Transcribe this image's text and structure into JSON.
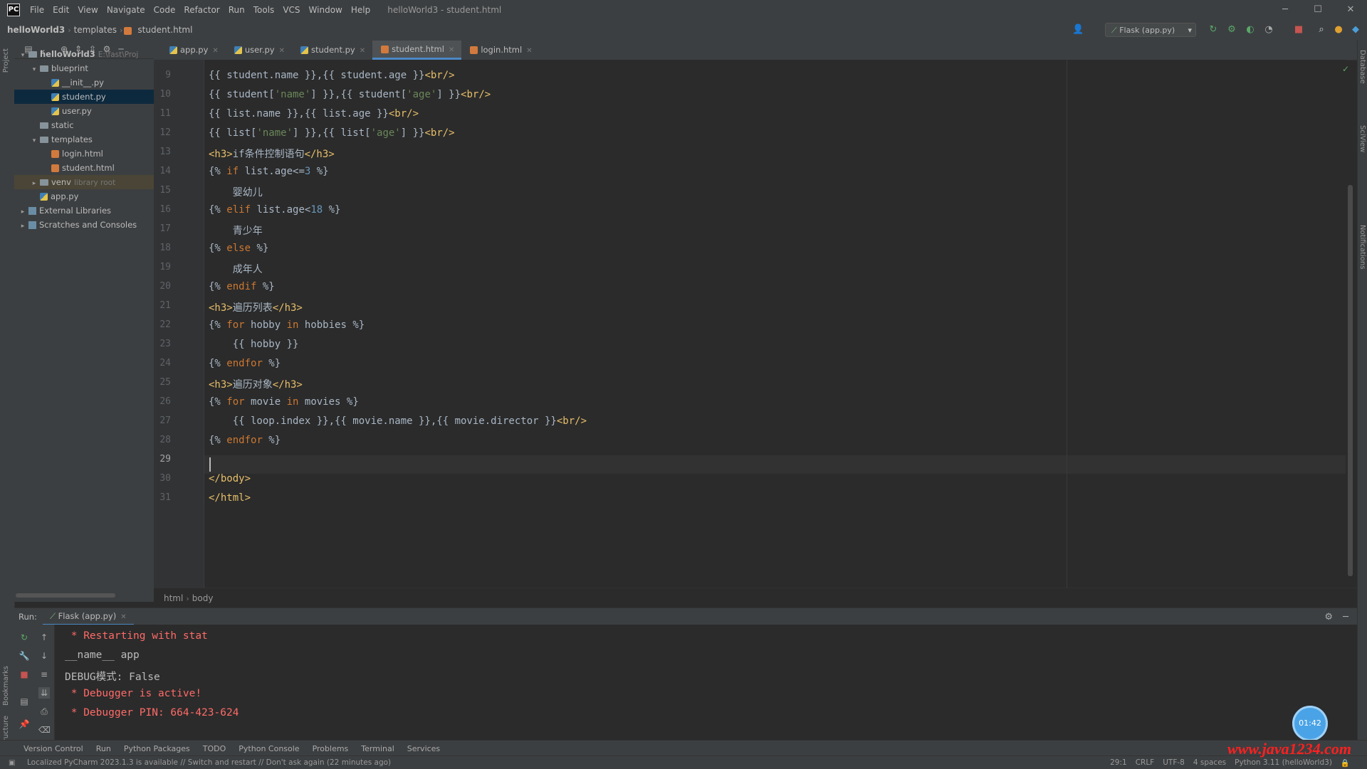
{
  "menubar": {
    "logo": "PC",
    "items": [
      "File",
      "Edit",
      "View",
      "Navigate",
      "Code",
      "Refactor",
      "Run",
      "Tools",
      "VCS",
      "Window",
      "Help"
    ],
    "window_title": "helloWorld3 - student.html",
    "minimize": "─",
    "maximize": "☐",
    "close": "✕"
  },
  "navbar": {
    "crumbs": [
      "helloWorld3",
      "templates",
      "student.html"
    ],
    "run_config": "Flask (app.py)"
  },
  "left_strip": {
    "project_label": "Project",
    "bookmarks_label": "Bookmarks",
    "structure_label": "Structure"
  },
  "right_strip": {
    "labels": [
      "Database",
      "SciView",
      "Notifications"
    ]
  },
  "project_tree": [
    {
      "label": "helloWorld3",
      "extra": "E:\\fast\\Proj",
      "depth": 0,
      "kind": "folder",
      "arrow": "▾"
    },
    {
      "label": "blueprint",
      "extra": "",
      "depth": 1,
      "kind": "folder",
      "arrow": "▾"
    },
    {
      "label": "__init__.py",
      "extra": "",
      "depth": 2,
      "kind": "py",
      "arrow": ""
    },
    {
      "label": "student.py",
      "extra": "",
      "depth": 2,
      "kind": "py",
      "arrow": "",
      "selected": true
    },
    {
      "label": "user.py",
      "extra": "",
      "depth": 2,
      "kind": "py",
      "arrow": ""
    },
    {
      "label": "static",
      "extra": "",
      "depth": 1,
      "kind": "folder",
      "arrow": ""
    },
    {
      "label": "templates",
      "extra": "",
      "depth": 1,
      "kind": "folder",
      "arrow": "▾"
    },
    {
      "label": "login.html",
      "extra": "",
      "depth": 2,
      "kind": "html",
      "arrow": ""
    },
    {
      "label": "student.html",
      "extra": "",
      "depth": 2,
      "kind": "html",
      "arrow": ""
    },
    {
      "label": "venv",
      "extra": "library root",
      "depth": 1,
      "kind": "folder",
      "arrow": "▸",
      "hl": true
    },
    {
      "label": "app.py",
      "extra": "",
      "depth": 1,
      "kind": "py",
      "arrow": ""
    },
    {
      "label": "External Libraries",
      "extra": "",
      "depth": 0,
      "kind": "lib",
      "arrow": "▸"
    },
    {
      "label": "Scratches and Consoles",
      "extra": "",
      "depth": 0,
      "kind": "lib",
      "arrow": "▸"
    }
  ],
  "tabs": [
    {
      "label": "app.py",
      "kind": "py"
    },
    {
      "label": "user.py",
      "kind": "py"
    },
    {
      "label": "student.py",
      "kind": "py"
    },
    {
      "label": "student.html",
      "kind": "html",
      "active": true
    },
    {
      "label": "login.html",
      "kind": "html"
    }
  ],
  "editor": {
    "line_numbers": [
      "9",
      "10",
      "11",
      "12",
      "13",
      "14",
      "15",
      "16",
      "17",
      "18",
      "19",
      "20",
      "21",
      "22",
      "23",
      "24",
      "25",
      "26",
      "27",
      "28",
      "29",
      "30",
      "31"
    ],
    "current_line": "29"
  },
  "breadcrumbs": [
    "html",
    "body"
  ],
  "run_panel": {
    "title": "Run:",
    "tab": "Flask (app.py)",
    "console": [
      {
        "text": " * Restarting with stat",
        "style": "red"
      },
      {
        "text": "__name__ app",
        "style": "gray"
      },
      {
        "text": "DEBUG模式: False",
        "style": "gray"
      },
      {
        "text": " * Debugger is active!",
        "style": "red"
      },
      {
        "text": " * Debugger PIN: 664-423-624",
        "style": "red"
      }
    ],
    "timer": "01:42"
  },
  "bottom_tools": [
    "Version Control",
    "Run",
    "Python Packages",
    "TODO",
    "Python Console",
    "Problems",
    "Terminal",
    "Services"
  ],
  "status": {
    "message": "Localized PyCharm 2023.1.3 is available // Switch and restart // Don't ask again (22 minutes ago)",
    "position": "29:1",
    "line_sep": "CRLF",
    "encoding": "UTF-8",
    "indent": "4 spaces",
    "interpreter": "Python 3.11 (helloWorld3)"
  },
  "watermark": "www.java1234.com",
  "colors": {
    "accent": "#4a88c7",
    "tag": "#e8bf6a",
    "keyword": "#cc7832",
    "string": "#6a8759",
    "number": "#6897bb",
    "console_red": "#ff6b68"
  }
}
